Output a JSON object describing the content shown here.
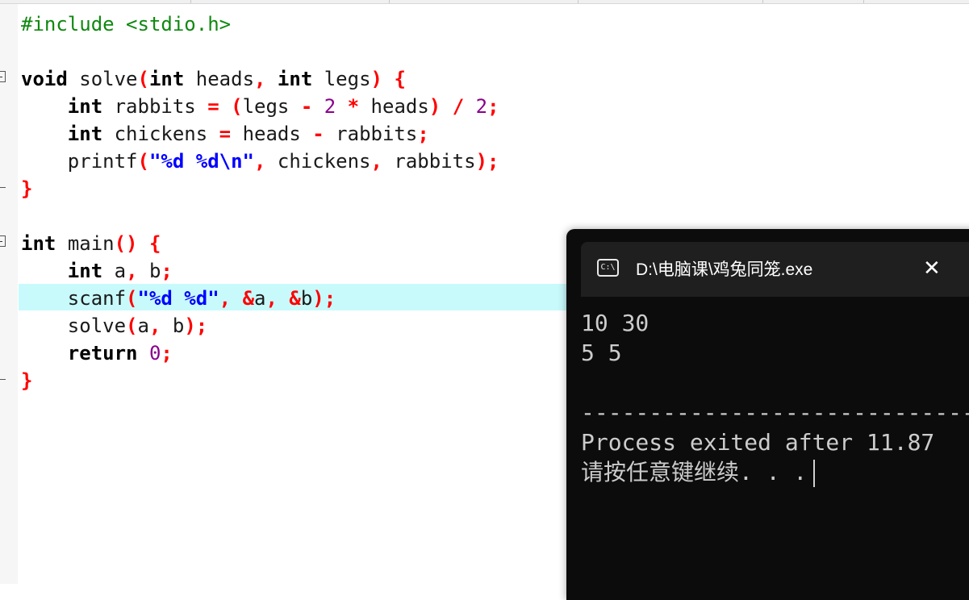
{
  "code": {
    "include_line": "#include <stdio.h>",
    "keywords": {
      "void": "void",
      "int": "int",
      "return": "return"
    },
    "identifiers": {
      "solve": "solve",
      "heads": "heads",
      "legs": "legs",
      "rabbits": "rabbits",
      "chickens": "chickens",
      "printf": "printf",
      "main": "main",
      "a": "a",
      "b": "b",
      "scanf": "scanf"
    },
    "numbers": {
      "two": "2",
      "zero": "0"
    },
    "strings": {
      "printf_fmt": "\"%d %d\\n\"",
      "scanf_fmt": "\"%d %d\""
    },
    "highlighted_line": 10
  },
  "console": {
    "title": "D:\\电脑课\\鸡兔同笼.exe",
    "icon_label": "C:\\",
    "close_glyph": "✕",
    "lines": [
      "10 30",
      "5 5",
      "",
      "--------------------------------",
      "Process exited after 11.87",
      "请按任意键继续. . ."
    ]
  }
}
